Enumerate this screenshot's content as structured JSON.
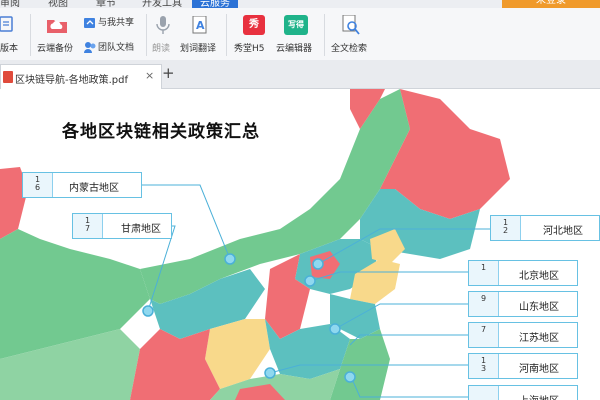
{
  "menubar": {
    "tabs": [
      "审阅",
      "视图",
      "章节",
      "开发工具",
      "云服务"
    ],
    "active_tab": "云服务",
    "login_label": "未登录"
  },
  "ribbon": {
    "items": [
      {
        "label": "版本",
        "icon": "version-icon"
      },
      {
        "label": "云端备份",
        "icon": "cloud-folder-icon"
      },
      {
        "label": "与我共享",
        "icon": "share-icon"
      },
      {
        "label": "团队文档",
        "icon": "team-doc-icon"
      },
      {
        "label": "朗读",
        "icon": "microphone-icon"
      },
      {
        "label": "划词翻译",
        "icon": "translate-icon"
      },
      {
        "label": "秀堂H5",
        "icon": "xiutang-icon",
        "badge": "秀"
      },
      {
        "label": "云编辑器",
        "icon": "cloud-editor-icon",
        "badge": "写得"
      },
      {
        "label": "全文检索",
        "icon": "search-doc-icon"
      }
    ]
  },
  "doc_tabs": {
    "active": {
      "name": "区块链导航-各地政策.pdf",
      "close": "×"
    },
    "add": "+"
  },
  "document": {
    "title": "各地区块链相关政策汇总",
    "labels": [
      {
        "num": "1\n6",
        "text": "内蒙古地区"
      },
      {
        "num": "1\n7",
        "text": "甘肃地区"
      },
      {
        "num": "1\n2",
        "text": "河北地区"
      },
      {
        "num": "1",
        "text": "北京地区"
      },
      {
        "num": "9",
        "text": "山东地区"
      },
      {
        "num": "7",
        "text": "江苏地区"
      },
      {
        "num": "1\n3",
        "text": "河南地区"
      },
      {
        "num": "",
        "text": "上海地区"
      }
    ]
  },
  "colors": {
    "accent": "#2b72d6",
    "login": "#f09a2b",
    "label_border": "#67c1e3",
    "map_green": "#72c990",
    "map_red": "#f06e74",
    "map_teal": "#5cc0bf",
    "map_yellow": "#f8d98b"
  }
}
